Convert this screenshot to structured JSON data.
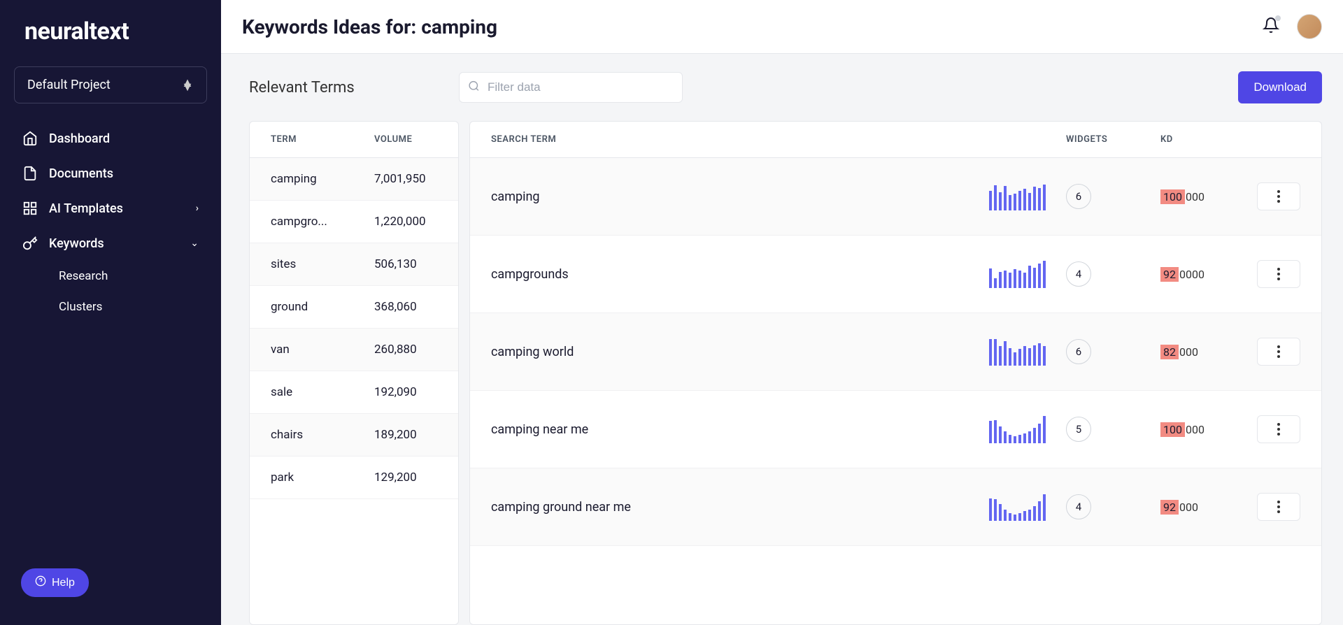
{
  "brand": "neuraltext",
  "project_selector": {
    "label": "Default Project"
  },
  "nav": {
    "dashboard": "Dashboard",
    "documents": "Documents",
    "ai_templates": "AI Templates",
    "keywords": "Keywords",
    "sub_research": "Research",
    "sub_clusters": "Clusters"
  },
  "help_label": "Help",
  "header": {
    "title": "Keywords Ideas for: camping"
  },
  "relevant_terms_title": "Relevant Terms",
  "filter_placeholder": "Filter data",
  "download_label": "Download",
  "left_table": {
    "col_term": "TERM",
    "col_volume": "VOLUME",
    "rows": [
      {
        "term": "camping",
        "volume": "7,001,950"
      },
      {
        "term": "campgro...",
        "volume": "1,220,000"
      },
      {
        "term": "sites",
        "volume": "506,130"
      },
      {
        "term": "ground",
        "volume": "368,060"
      },
      {
        "term": "van",
        "volume": "260,880"
      },
      {
        "term": "sale",
        "volume": "192,090"
      },
      {
        "term": "chairs",
        "volume": "189,200"
      },
      {
        "term": "park",
        "volume": "129,200"
      }
    ]
  },
  "right_table": {
    "col_term": "SEARCH TERM",
    "col_widgets": "WIDGETS",
    "col_kd": "KD",
    "rows": [
      {
        "term": "camping",
        "widgets": "6",
        "kd": "100",
        "vol_suffix": "000",
        "spark": [
          70,
          90,
          65,
          88,
          55,
          60,
          70,
          78,
          62,
          85,
          80,
          93
        ]
      },
      {
        "term": "campgrounds",
        "widgets": "4",
        "kd": "92",
        "vol_suffix": "0000",
        "spark": [
          70,
          35,
          58,
          62,
          55,
          68,
          62,
          55,
          80,
          72,
          88,
          98
        ]
      },
      {
        "term": "camping world",
        "widgets": "6",
        "kd": "82",
        "vol_suffix": "000",
        "spark": [
          95,
          95,
          70,
          88,
          62,
          48,
          60,
          70,
          62,
          72,
          80,
          70
        ]
      },
      {
        "term": "camping near me",
        "widgets": "5",
        "kd": "100",
        "vol_suffix": "000",
        "spark": [
          80,
          82,
          60,
          42,
          30,
          25,
          30,
          35,
          42,
          55,
          70,
          98
        ]
      },
      {
        "term": "camping ground near me",
        "widgets": "4",
        "kd": "92",
        "vol_suffix": "000",
        "spark": [
          80,
          78,
          60,
          40,
          28,
          22,
          28,
          35,
          40,
          52,
          70,
          95
        ]
      }
    ]
  }
}
